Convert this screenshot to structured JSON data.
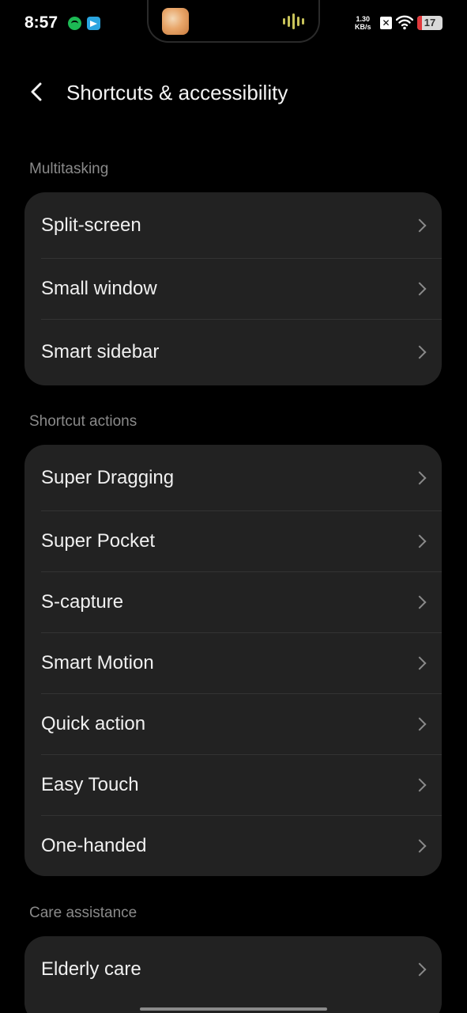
{
  "status_bar": {
    "time": "8:57",
    "net_speed_value": "1.30",
    "net_speed_unit": "KB/s",
    "battery_level": "17",
    "icons": [
      "spotify-icon",
      "telegram-icon",
      "media-art-icon",
      "audio-wave-icon",
      "x-icon",
      "wifi-icon",
      "battery-icon"
    ]
  },
  "header": {
    "title": "Shortcuts & accessibility",
    "back_icon": "chevron-left-icon"
  },
  "sections": [
    {
      "label": "Multitasking",
      "items": [
        {
          "label": "Split-screen"
        },
        {
          "label": "Small window"
        },
        {
          "label": "Smart sidebar"
        }
      ]
    },
    {
      "label": "Shortcut actions",
      "items": [
        {
          "label": "Super Dragging"
        },
        {
          "label": "Super Pocket"
        },
        {
          "label": "S-capture"
        },
        {
          "label": "Smart Motion"
        },
        {
          "label": "Quick action"
        },
        {
          "label": "Easy Touch"
        },
        {
          "label": "One-handed"
        }
      ]
    },
    {
      "label": "Care assistance",
      "items": [
        {
          "label": "Elderly care"
        }
      ]
    }
  ],
  "colors": {
    "background": "#000000",
    "card": "#222222",
    "section_label": "#8a8a8a",
    "battery_low": "#e0383b"
  }
}
